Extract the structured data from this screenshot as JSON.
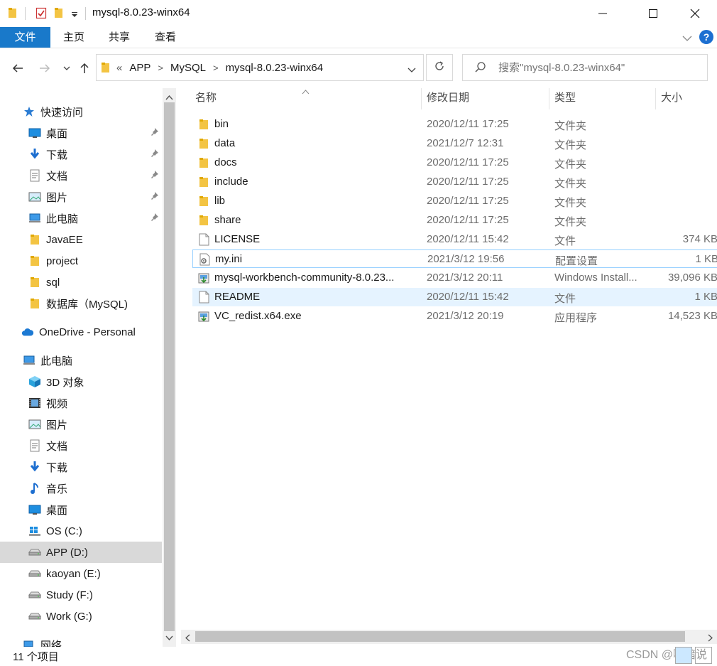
{
  "window": {
    "title": "mysql-8.0.23-winx64",
    "minimize_glyph": "—",
    "maximize_glyph": "☐",
    "close_glyph": "✕"
  },
  "ribbon": {
    "tabs": [
      "文件",
      "主页",
      "共享",
      "查看"
    ],
    "help": "?"
  },
  "address": {
    "overflow": "«",
    "crumbs": [
      "APP",
      "MySQL",
      "mysql-8.0.23-winx64"
    ]
  },
  "search": {
    "placeholder": "搜索\"mysql-8.0.23-winx64\""
  },
  "sidebar": {
    "items": [
      {
        "label": "快速访问",
        "icon": "star-icon"
      },
      {
        "label": "桌面",
        "icon": "desktop-icon",
        "pinned": true
      },
      {
        "label": "下载",
        "icon": "download-icon",
        "pinned": true
      },
      {
        "label": "文档",
        "icon": "document-icon",
        "pinned": true
      },
      {
        "label": "图片",
        "icon": "picture-icon",
        "pinned": true
      },
      {
        "label": "此电脑",
        "icon": "computer-icon",
        "pinned": true
      },
      {
        "label": "JavaEE",
        "icon": "folder-icon"
      },
      {
        "label": "project",
        "icon": "folder-icon"
      },
      {
        "label": "sql",
        "icon": "folder-icon"
      },
      {
        "label": "数据库（MySQL)",
        "icon": "folder-icon"
      },
      {
        "label": "OneDrive - Personal",
        "icon": "cloud-icon"
      },
      {
        "label": "此电脑",
        "icon": "computer-icon"
      },
      {
        "label": "3D 对象",
        "icon": "cube-icon"
      },
      {
        "label": "视频",
        "icon": "video-icon"
      },
      {
        "label": "图片",
        "icon": "picture-icon"
      },
      {
        "label": "文档",
        "icon": "document-icon"
      },
      {
        "label": "下载",
        "icon": "download-icon"
      },
      {
        "label": "音乐",
        "icon": "music-icon"
      },
      {
        "label": "桌面",
        "icon": "desktop-icon"
      },
      {
        "label": "OS (C:)",
        "icon": "windows-drive-icon"
      },
      {
        "label": "APP (D:)",
        "icon": "drive-icon",
        "selected": true
      },
      {
        "label": "kaoyan (E:)",
        "icon": "drive-icon"
      },
      {
        "label": "Study (F:)",
        "icon": "drive-icon"
      },
      {
        "label": "Work (G:)",
        "icon": "drive-icon"
      },
      {
        "label": "网络",
        "icon": "network-icon"
      }
    ]
  },
  "columns": {
    "name": "名称",
    "date": "修改日期",
    "type": "类型",
    "size": "大小"
  },
  "files": [
    {
      "name": "bin",
      "date": "2020/12/11 17:25",
      "type": "文件夹",
      "size": "",
      "icon": "folder-icon"
    },
    {
      "name": "data",
      "date": "2021/12/7 12:31",
      "type": "文件夹",
      "size": "",
      "icon": "folder-icon"
    },
    {
      "name": "docs",
      "date": "2020/12/11 17:25",
      "type": "文件夹",
      "size": "",
      "icon": "folder-icon"
    },
    {
      "name": "include",
      "date": "2020/12/11 17:25",
      "type": "文件夹",
      "size": "",
      "icon": "folder-icon"
    },
    {
      "name": "lib",
      "date": "2020/12/11 17:25",
      "type": "文件夹",
      "size": "",
      "icon": "folder-icon"
    },
    {
      "name": "share",
      "date": "2020/12/11 17:25",
      "type": "文件夹",
      "size": "",
      "icon": "folder-icon"
    },
    {
      "name": "LICENSE",
      "date": "2020/12/11 15:42",
      "type": "文件",
      "size": "374 KB",
      "icon": "file-icon"
    },
    {
      "name": "my.ini",
      "date": "2021/3/12 19:56",
      "type": "配置设置",
      "size": "1 KB",
      "icon": "settings-file-icon"
    },
    {
      "name": "mysql-workbench-community-8.0.23...",
      "date": "2021/3/12 20:11",
      "type": "Windows Install...",
      "size": "39,096 KB",
      "icon": "installer-icon"
    },
    {
      "name": "README",
      "date": "2020/12/11 15:42",
      "type": "文件",
      "size": "1 KB",
      "icon": "file-icon"
    },
    {
      "name": "VC_redist.x64.exe",
      "date": "2021/3/12 20:19",
      "type": "应用程序",
      "size": "14,523 KB",
      "icon": "installer-icon"
    }
  ],
  "status": {
    "count": "11 个项目",
    "watermark": "CSDN @啸暗说"
  },
  "colors": {
    "accent": "#1979ca",
    "folder": "#f3c443",
    "hover_row": "#e5f3ff",
    "selected_nav": "#d9d9d9"
  }
}
